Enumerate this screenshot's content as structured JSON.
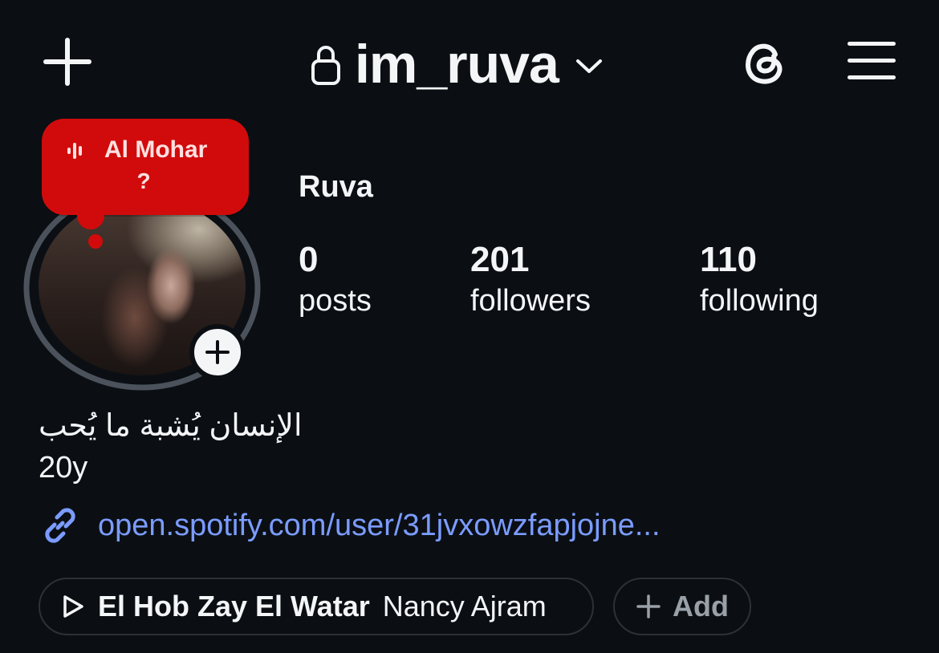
{
  "header": {
    "username": "im_ruva",
    "icons": [
      "plus-icon",
      "lock-icon",
      "chevron-down-icon",
      "threads-icon",
      "menu-icon"
    ]
  },
  "note": {
    "title": "Al Mohar",
    "subtitle": "?",
    "color": "#d10b0b"
  },
  "profile": {
    "display_name": "Ruva",
    "stats": [
      {
        "value": "0",
        "label": "posts"
      },
      {
        "value": "201",
        "label": "followers"
      },
      {
        "value": "110",
        "label": "following"
      }
    ],
    "bio": [
      "الإنسان يُشبة ما يُحب",
      "20y"
    ],
    "link": "open.spotify.com/user/31jvxowzfapjojne..."
  },
  "music": {
    "song": "El Hob Zay El Watar",
    "artist": "Nancy Ajram"
  },
  "add_button": {
    "label": "Add"
  },
  "colors": {
    "background": "#0b0f14",
    "link": "#7b9cff",
    "note": "#d10b0b"
  }
}
